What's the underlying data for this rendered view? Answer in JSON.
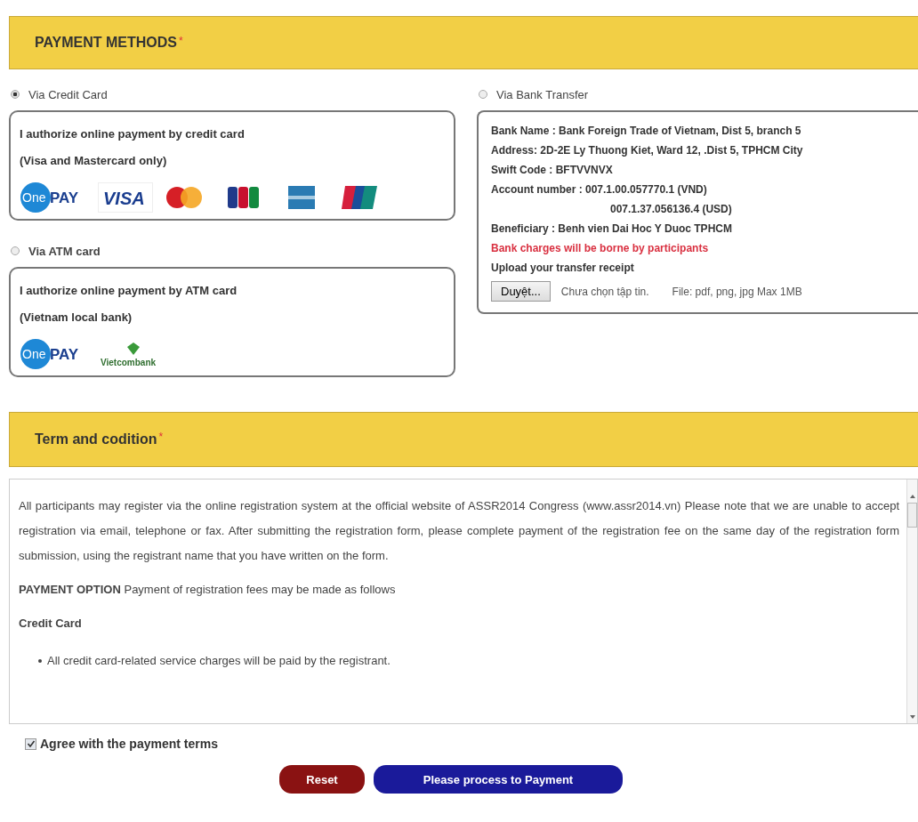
{
  "payment_methods": {
    "title": "PAYMENT METHODS",
    "required_mark": "*",
    "options": [
      {
        "kind": "card",
        "label": "Via Credit Card",
        "selected": true,
        "lines": [
          "I authorize online payment by credit card",
          "(Visa and Mastercard only)"
        ],
        "logos": [
          {
            "kind": "onepay",
            "mark": "One",
            "label": "PAY"
          },
          {
            "kind": "visa",
            "label": "VISA"
          },
          {
            "kind": "mastercard"
          },
          {
            "kind": "jcb"
          },
          {
            "kind": "amex"
          },
          {
            "kind": "unionpay"
          }
        ]
      },
      {
        "kind": "atm",
        "label": "Via ATM card",
        "selected": false,
        "lines": [
          "I authorize online payment by ATM card",
          "(Vietnam local bank)"
        ],
        "logos": [
          {
            "kind": "onepay",
            "mark": "One",
            "label": "PAY"
          },
          {
            "kind": "vietcombank",
            "label": "Vietcombank"
          }
        ]
      },
      {
        "kind": "bank",
        "label": "Via Bank Transfer",
        "selected": false,
        "details": [
          {
            "kind": "text",
            "text": "Bank Name : Bank Foreign Trade of Vietnam, Dist 5, branch 5"
          },
          {
            "kind": "text",
            "text": "Address: 2D-2E Ly Thuong Kiet, Ward 12, .Dist 5, TPHCM City"
          },
          {
            "kind": "text",
            "text": "Swift Code : BFTVVNVX"
          },
          {
            "kind": "text",
            "text": "Account number : 007.1.00.057770.1 (VND)"
          },
          {
            "kind": "indent",
            "text": "007.1.37.056136.4 (USD)"
          },
          {
            "kind": "text",
            "text": "Beneficiary : Benh vien Dai Hoc Y Duoc TPHCM"
          },
          {
            "kind": "warning",
            "text": "Bank charges will be borne by participants"
          },
          {
            "kind": "text",
            "text": "Upload your transfer receipt"
          }
        ],
        "upload": {
          "button": "Duyệt...",
          "status": "Chưa chọn tập tin.",
          "hint": "File: pdf, png, jpg Max 1MB"
        }
      }
    ]
  },
  "terms": {
    "title": "Term and codition",
    "required_mark": "*",
    "content": [
      {
        "kind": "paragraph",
        "text": "All participants may register via the online registration system at the official website of ASSR2014 Congress (www.assr2014.vn) Please note that we are unable to accept registration via email, telephone or fax. After submitting the registration form, please complete payment of the registration fee on the same day of the registration form submission, using the registrant name that you have written on the form."
      },
      {
        "kind": "paragraph",
        "text": "**PAYMENT OPTION** Payment of registration fees may be made as follows"
      },
      {
        "kind": "heading",
        "text": "Credit Card"
      },
      {
        "kind": "bullet",
        "text": "All credit card-related service charges will be paid by the registrant."
      }
    ]
  },
  "agree": {
    "label": "Agree with the payment terms",
    "checked": true
  },
  "buttons": [
    {
      "kind": "reset",
      "label": "Reset"
    },
    {
      "kind": "submit",
      "label": "Please process to Payment"
    }
  ]
}
